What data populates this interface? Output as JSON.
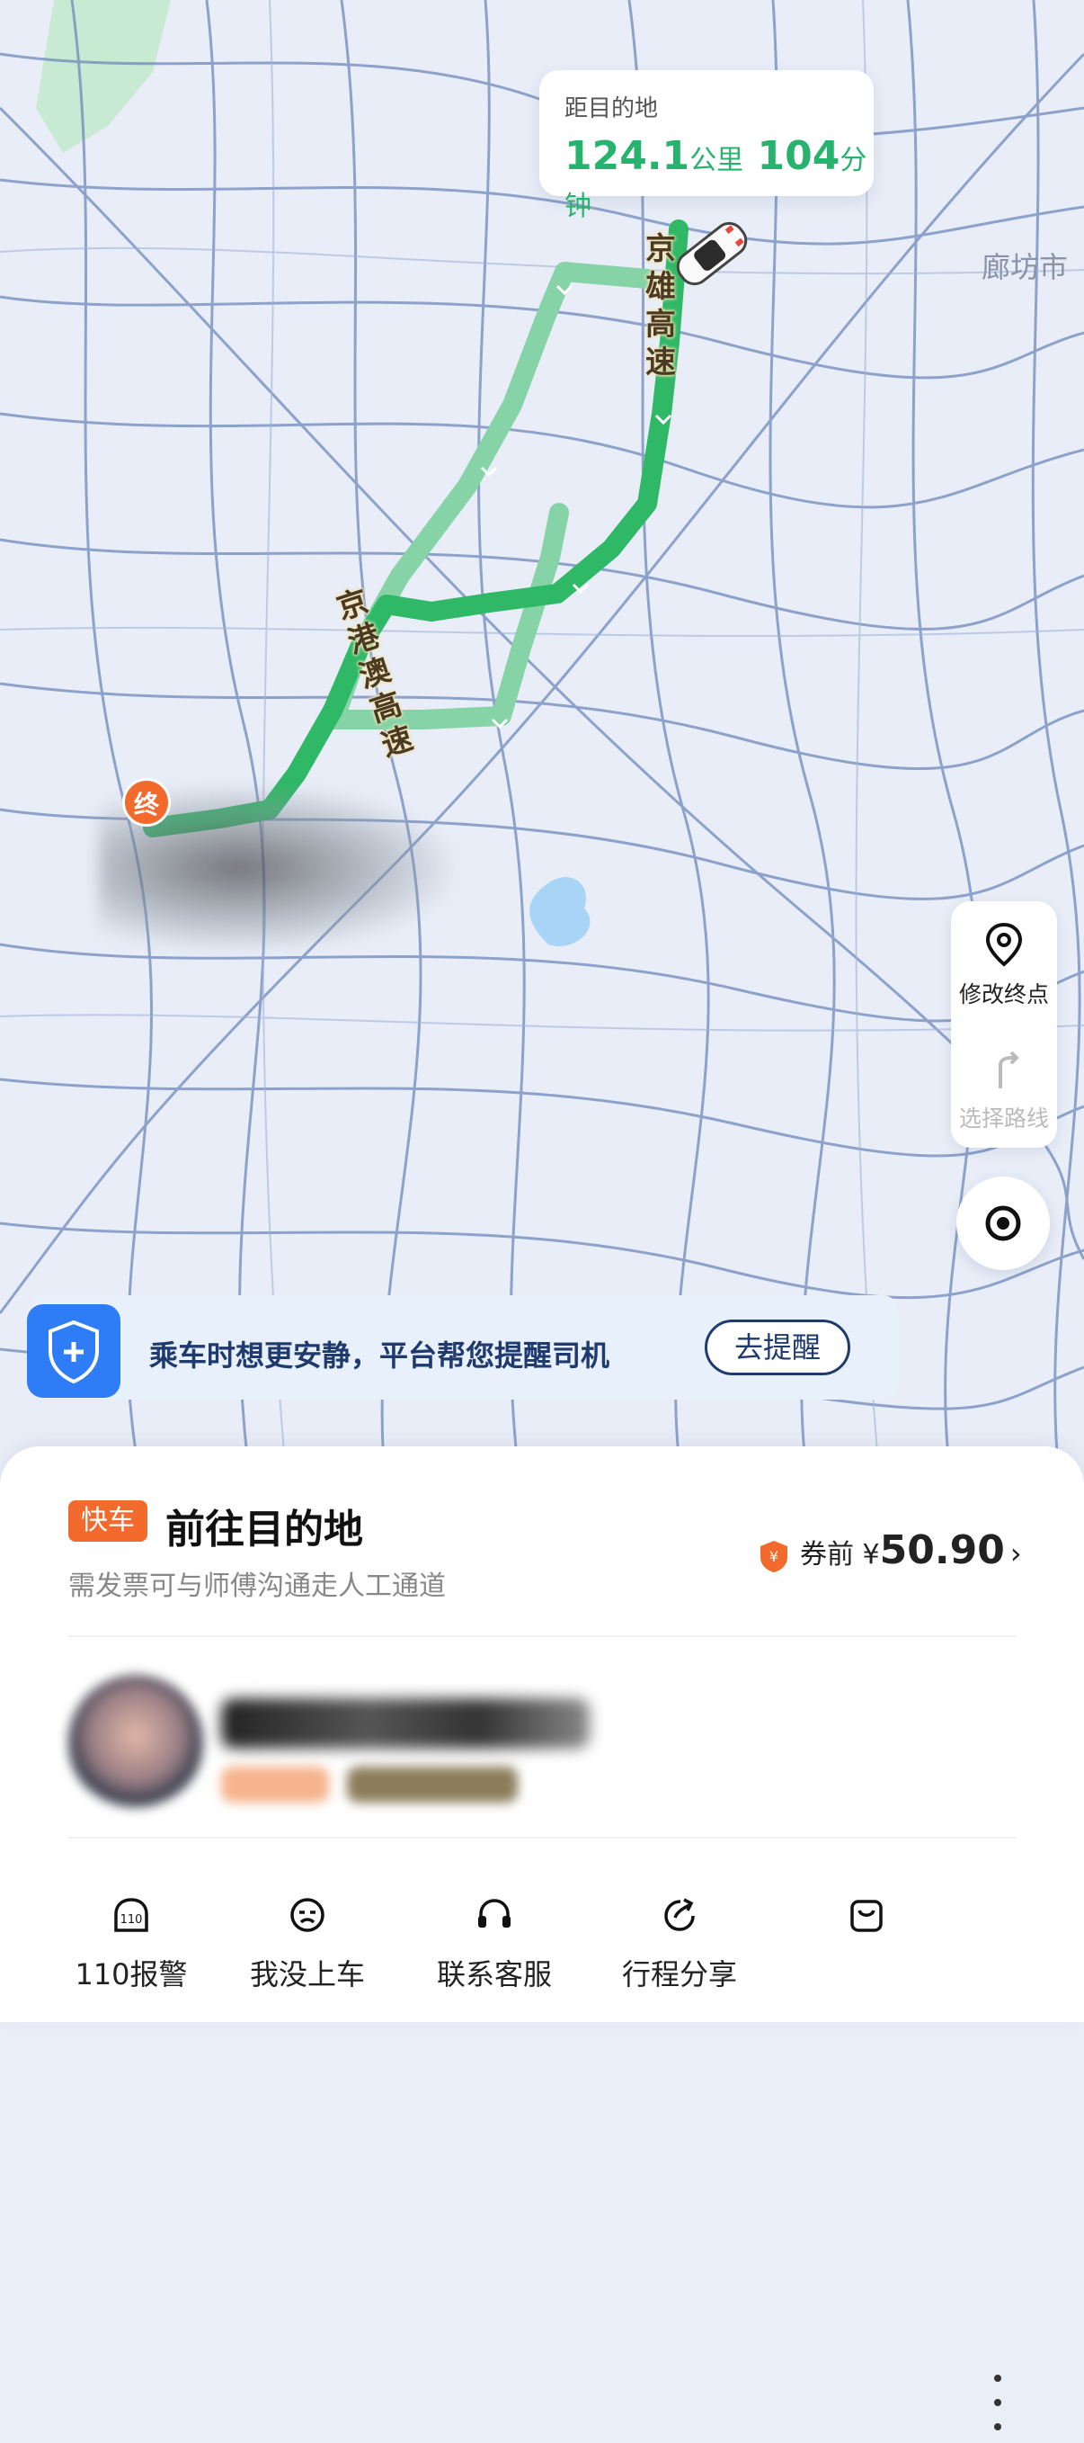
{
  "map": {
    "distance_label": "距目的地",
    "distance_km": "124.1",
    "distance_km_unit": "公里",
    "duration_min": "104",
    "duration_unit": "分钟",
    "city_label": "廊坊市",
    "road_labels": [
      "京雄高速",
      "京港澳高速"
    ],
    "end_marker": "终",
    "colors": {
      "route_active": "#2fb866",
      "route_alt": "#7fd3a4",
      "road": "#6c86b8"
    }
  },
  "side_controls": {
    "edit_destination": "修改终点",
    "choose_route": "选择路线"
  },
  "banner": {
    "text": "乘车时想更安静，平台帮您提醒司机",
    "button": "去提醒"
  },
  "trip": {
    "tag": "快车",
    "title": "前往目的地",
    "subtitle": "需发票可与师傅沟通走人工通道",
    "price_prefix": "券前",
    "price_currency": "¥",
    "price_amount": "50.90"
  },
  "actions": [
    {
      "label": "110报警",
      "icon": "police-110-icon"
    },
    {
      "label": "我没上车",
      "icon": "not-boarded-icon"
    },
    {
      "label": "联系客服",
      "icon": "headset-icon"
    },
    {
      "label": "行程分享",
      "icon": "share-icon"
    },
    {
      "label": "",
      "icon": "bag-icon"
    }
  ]
}
